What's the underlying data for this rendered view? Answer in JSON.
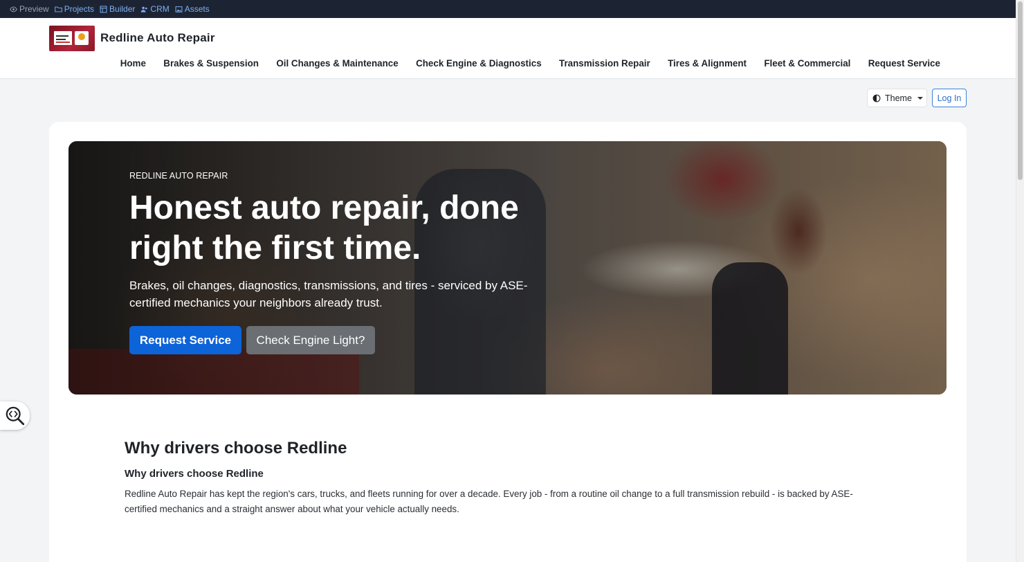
{
  "adminbar": {
    "items": [
      {
        "label": "Preview",
        "icon": "eye-icon"
      },
      {
        "label": "Projects",
        "icon": "folder-icon"
      },
      {
        "label": "Builder",
        "icon": "layout-icon"
      },
      {
        "label": "CRM",
        "icon": "users-icon"
      },
      {
        "label": "Assets",
        "icon": "image-icon"
      }
    ]
  },
  "header": {
    "brand": "Redline Auto Repair",
    "nav": [
      "Home",
      "Brakes & Suspension",
      "Oil Changes & Maintenance",
      "Check Engine & Diagnostics",
      "Transmission Repair",
      "Tires & Alignment",
      "Fleet & Commercial",
      "Request Service"
    ]
  },
  "controls": {
    "theme_label": "Theme",
    "login_label": "Log In"
  },
  "hero": {
    "eyebrow": "REDLINE AUTO REPAIR",
    "title": "Honest auto repair, done right the first time.",
    "lead": "Brakes, oil changes, diagnostics, transmissions, and tires - serviced by ASE-certified mechanics your neighbors already trust.",
    "primary_cta": "Request Service",
    "secondary_cta": "Check Engine Light?"
  },
  "why": {
    "title": "Why drivers choose Redline",
    "subtitle": "Why drivers choose Redline",
    "body": "Redline Auto Repair has kept the region's cars, trucks, and fleets running for over a decade. Every job - from a routine oil change to a full transmission rebuild - is backed by ASE-certified mechanics and a straight answer about what your vehicle actually needs."
  },
  "colors": {
    "adminbar": "#1c2434",
    "primary": "#0d63d8",
    "secondary": "#6b6e72",
    "brand_logo": "#b0243a"
  }
}
